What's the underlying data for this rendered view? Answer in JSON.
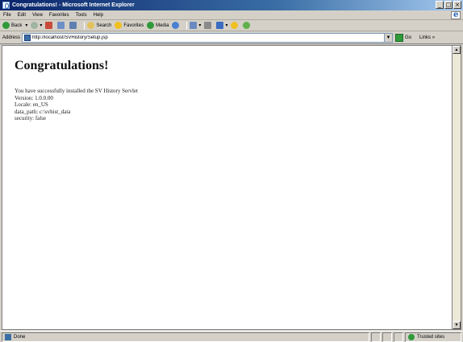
{
  "window": {
    "title": "Congratulations! - Microsoft Internet Explorer",
    "minimize_glyph": "_",
    "maximize_glyph": "□",
    "close_glyph": "×"
  },
  "menubar": {
    "items": [
      "File",
      "Edit",
      "View",
      "Favorites",
      "Tools",
      "Help"
    ]
  },
  "toolbar": {
    "back_label": "Back",
    "search_label": "Search",
    "favorites_label": "Favorites",
    "media_label": "Media"
  },
  "addressbar": {
    "label": "Address",
    "url": "http://localhost/SVHistory/Setup.jsp",
    "dropdown_glyph": "▼",
    "go_label": "Go",
    "links_label": "Links »"
  },
  "page": {
    "heading": "Congratulations!",
    "lines": [
      "You have successfully installed the SV History Servlet",
      "Version: 1.0.0.00",
      "Locale: en_US",
      "data_path: c:\\svhist_data",
      "security: false"
    ]
  },
  "statusbar": {
    "text": "Done",
    "zone": "Trusted sites"
  },
  "scrollbar": {
    "up_glyph": "▲",
    "down_glyph": "▼"
  },
  "icons": {
    "app": "ie-page-icon",
    "ie_logo": "ie-logo-icon"
  },
  "colors": {
    "titlebar": "#0a246a",
    "chrome": "#d4d0c8",
    "page_background": "#ffffff"
  }
}
